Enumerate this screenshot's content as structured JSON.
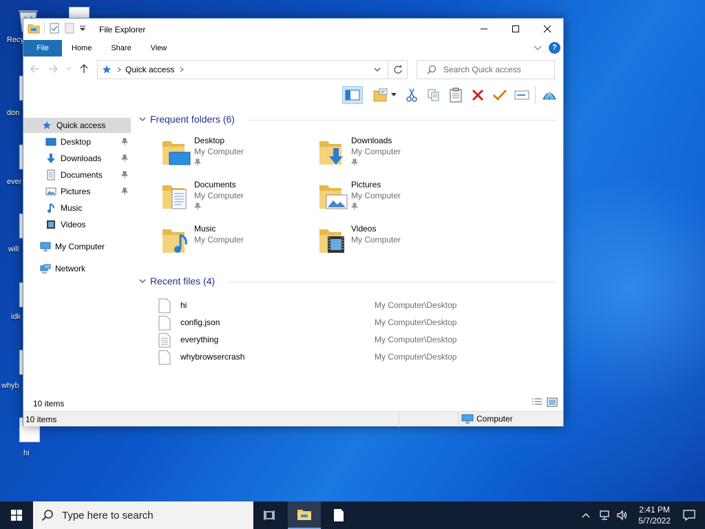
{
  "desktop": {
    "icons": [
      {
        "label": "Recy"
      },
      {
        "label": "don"
      },
      {
        "label": "ever"
      },
      {
        "label": "will"
      },
      {
        "label": "idk"
      },
      {
        "label": "whyb"
      },
      {
        "label": "hi"
      }
    ]
  },
  "window": {
    "title": "File Explorer",
    "ribbon_tabs": [
      "File",
      "Home",
      "Share",
      "View"
    ],
    "help_label": "?",
    "address": {
      "crumb": "Quick access"
    },
    "search": {
      "placeholder": "Search Quick access"
    }
  },
  "nav": {
    "quick_access": "Quick access",
    "pinned": [
      "Desktop",
      "Downloads",
      "Documents",
      "Pictures"
    ],
    "unpinned": [
      "Music",
      "Videos"
    ],
    "my_computer": "My Computer",
    "network": "Network"
  },
  "frequent": {
    "header": "Frequent folders (6)",
    "folders": [
      {
        "name": "Desktop",
        "location": "My Computer",
        "icon": "desktop-folder-icon"
      },
      {
        "name": "Downloads",
        "location": "My Computer",
        "icon": "downloads-folder-icon"
      },
      {
        "name": "Documents",
        "location": "My Computer",
        "icon": "documents-folder-icon"
      },
      {
        "name": "Pictures",
        "location": "My Computer",
        "icon": "pictures-folder-icon"
      },
      {
        "name": "Music",
        "location": "My Computer",
        "icon": "music-folder-icon"
      },
      {
        "name": "Videos",
        "location": "My Computer",
        "icon": "videos-folder-icon"
      }
    ]
  },
  "recent": {
    "header": "Recent files (4)",
    "files": [
      {
        "name": "hi",
        "path": "My Computer\\Desktop"
      },
      {
        "name": "config.json",
        "path": "My Computer\\Desktop"
      },
      {
        "name": "everything",
        "path": "My Computer\\Desktop"
      },
      {
        "name": "whybrowsercrash",
        "path": "My Computer\\Desktop"
      }
    ]
  },
  "status": {
    "items_top": "10 items",
    "items_bottom": "10 items",
    "location": "Computer"
  },
  "taskbar": {
    "search_placeholder": "Type here to search",
    "time": "2:41 PM",
    "date": "5/7/2022"
  },
  "colors": {
    "accent": "#1f6fb5",
    "folder": "#f2c55c",
    "header_blue": "#1e3287",
    "taskbar": "#101d33"
  }
}
